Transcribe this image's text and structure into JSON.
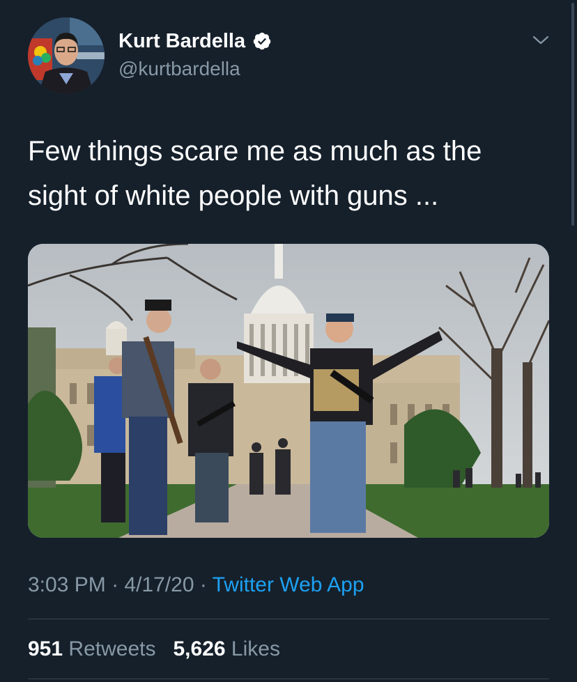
{
  "author": {
    "display_name": "Kurt Bardella",
    "handle": "@kurtbardella",
    "verified": true,
    "avatar_icon": "profile-photo"
  },
  "tweet": {
    "text_line1": "Few things scare me as much as the",
    "text_line2": "sight of white people with guns ..."
  },
  "media": {
    "kind": "photo"
  },
  "meta": {
    "time": "3:03 PM",
    "sep1": " · ",
    "date": "4/17/20",
    "sep2": " · ",
    "source": "Twitter Web App"
  },
  "stats": {
    "retweets_count": "951",
    "retweets_label": "Retweets",
    "likes_count": "5,626",
    "likes_label": "Likes"
  },
  "colors": {
    "background": "#15202b",
    "secondary_text": "#8899a6",
    "link": "#1da1f2",
    "divider": "#38444d"
  }
}
